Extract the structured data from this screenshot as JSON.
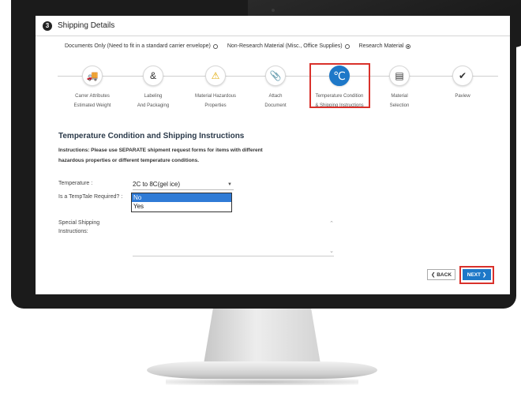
{
  "header": {
    "step_number": "3",
    "title": "Shipping Details"
  },
  "shipment_type": {
    "options": [
      {
        "label": "Documents Only (Need to fit in a standard carrier envelope)",
        "checked": false
      },
      {
        "label": "Non-Research Material (Misc., Office Supplies)",
        "checked": false
      },
      {
        "label": "Research Material",
        "checked": true
      }
    ]
  },
  "steps": [
    {
      "icon": "truck-icon",
      "glyph": "🚚",
      "line1": "Carrer Attributes",
      "line2": "Estimated Weight",
      "active": false
    },
    {
      "icon": "labeling-icon",
      "glyph": "&",
      "line1": "Labeling",
      "line2": "And Packaging",
      "active": false
    },
    {
      "icon": "warning-icon",
      "glyph": "⚠",
      "line1": "Material Hazardous",
      "line2": "Properties",
      "active": false
    },
    {
      "icon": "paperclip-icon",
      "glyph": "📎",
      "line1": "Attach",
      "line2": "Document",
      "active": false
    },
    {
      "icon": "temperature-icon",
      "glyph": "℃",
      "line1": "Temperature Condition",
      "line2": "& Shipping Instructions",
      "active": true
    },
    {
      "icon": "list-icon",
      "glyph": "▤",
      "line1": "Material",
      "line2": "Selection",
      "active": false
    },
    {
      "icon": "checkmark-icon",
      "glyph": "✔",
      "line1": "Paview",
      "line2": "",
      "active": false
    }
  ],
  "section": {
    "title": "Temperature Condition and Shipping Instructions",
    "instructions_line1": "Instructions: Please use SEPARATE shipment request forms for items with different",
    "instructions_line2": "hazardous properties or different temperature conditions."
  },
  "form": {
    "temperature_label": "Temperature :",
    "temperature_value": "2C to 8C(gel ice)",
    "temptale_label": "Is a TempTale Required? :",
    "temptale_options": [
      "No",
      "Yes"
    ],
    "temptale_selected": "No",
    "special_label_line1": "Special Shipping",
    "special_label_line2": "Instructions:",
    "special_value": ""
  },
  "buttons": {
    "back_label": "BACK",
    "next_label": "NEXT"
  },
  "colors": {
    "primary": "#1e78c8",
    "highlight": "#d9312b"
  }
}
